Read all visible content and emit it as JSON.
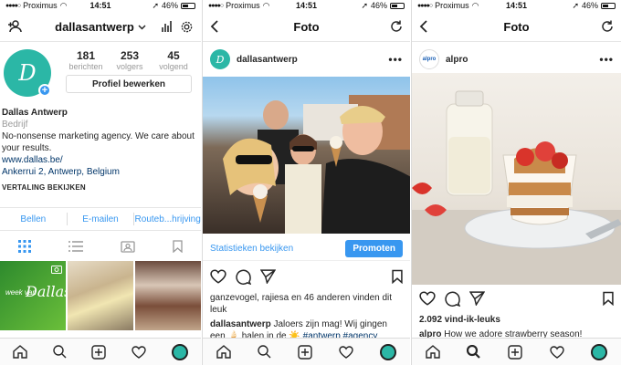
{
  "status": {
    "carrier": "Proximus",
    "time": "14:51",
    "battery": "46%"
  },
  "profile": {
    "username": "dallasantwerp",
    "posts": "181",
    "posts_label": "berichten",
    "followers": "253",
    "followers_label": "volgers",
    "following": "45",
    "following_label": "volgend",
    "edit_button": "Profiel bewerken",
    "name": "Dallas Antwerp",
    "category": "Bedrijf",
    "bio": "No-nonsense marketing agency. We care about your results.",
    "website": "www.dallas.be/",
    "address": "Ankerrui 2, Antwerp, Belgium",
    "see_translation": "VERTALING BEKIJKEN",
    "action_call": "Bellen",
    "action_email": "E-mailen",
    "action_route": "Routeb...hrijving",
    "thumb1_text": "week van"
  },
  "post1": {
    "title": "Foto",
    "username": "dallasantwerp",
    "insights_link": "Statistieken bekijken",
    "promote_button": "Promoten",
    "likes": "ganzevogel, rajiesa en 46 anderen vinden dit leuk",
    "caption_user": "dallasantwerp",
    "caption_text": "Jaloers zijn mag! Wij gingen een 🍦 halen in de ☀️",
    "hashtags": "#antwerp #agency"
  },
  "post2": {
    "title": "Foto",
    "username": "alpro",
    "avatar_text": "alpro",
    "likes": "2.092 vind-ik-leuks",
    "caption_user": "alpro",
    "caption_text": "How we adore strawberry season!"
  },
  "colors": {
    "accent": "#3897f0",
    "brand": "#2bb7a6"
  },
  "icons": [
    "add-user-icon",
    "insights-icon",
    "settings-icon",
    "back-icon",
    "refresh-icon",
    "more-icon",
    "grid-icon",
    "list-icon",
    "tagged-icon",
    "bookmark-icon",
    "heart-icon",
    "comment-icon",
    "share-icon",
    "home-icon",
    "search-icon",
    "add-post-icon",
    "activity-icon"
  ]
}
